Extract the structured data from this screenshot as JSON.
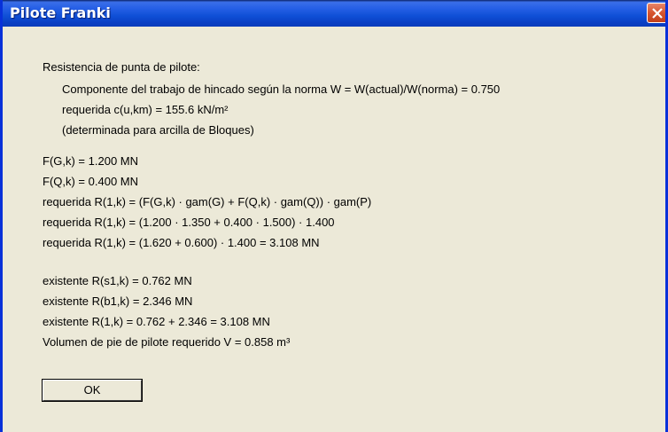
{
  "window": {
    "title": "Pilote Franki",
    "close_icon": "close-x-icon"
  },
  "content": {
    "section1": {
      "heading": "Resistencia de punta de pilote:",
      "lines": [
        "Componente del trabajo de hincado según la norma W  = W(actual)/W(norma) = 0.750",
        "requerida c(u,km) = 155.6 kN/m²",
        "(determinada para arcilla de Bloques)"
      ]
    },
    "section2": {
      "lines": [
        "F(G,k) = 1.200 MN",
        "F(Q,k) = 0.400 MN",
        "requerida R(1,k) = (F(G,k) · gam(G) + F(Q,k) · gam(Q)) · gam(P)",
        "requerida R(1,k) = (1.200 · 1.350 + 0.400 · 1.500) · 1.400",
        "requerida R(1,k) = (1.620 + 0.600) · 1.400 = 3.108 MN"
      ]
    },
    "section3": {
      "lines": [
        "existente R(s1,k) = 0.762 MN",
        "existente R(b1,k) = 2.346 MN",
        "existente R(1,k) = 0.762 + 2.346 = 3.108 MN",
        "Volumen de pie de pilote requerido V = 0.858 m³"
      ]
    }
  },
  "buttons": {
    "ok_label": "OK"
  }
}
